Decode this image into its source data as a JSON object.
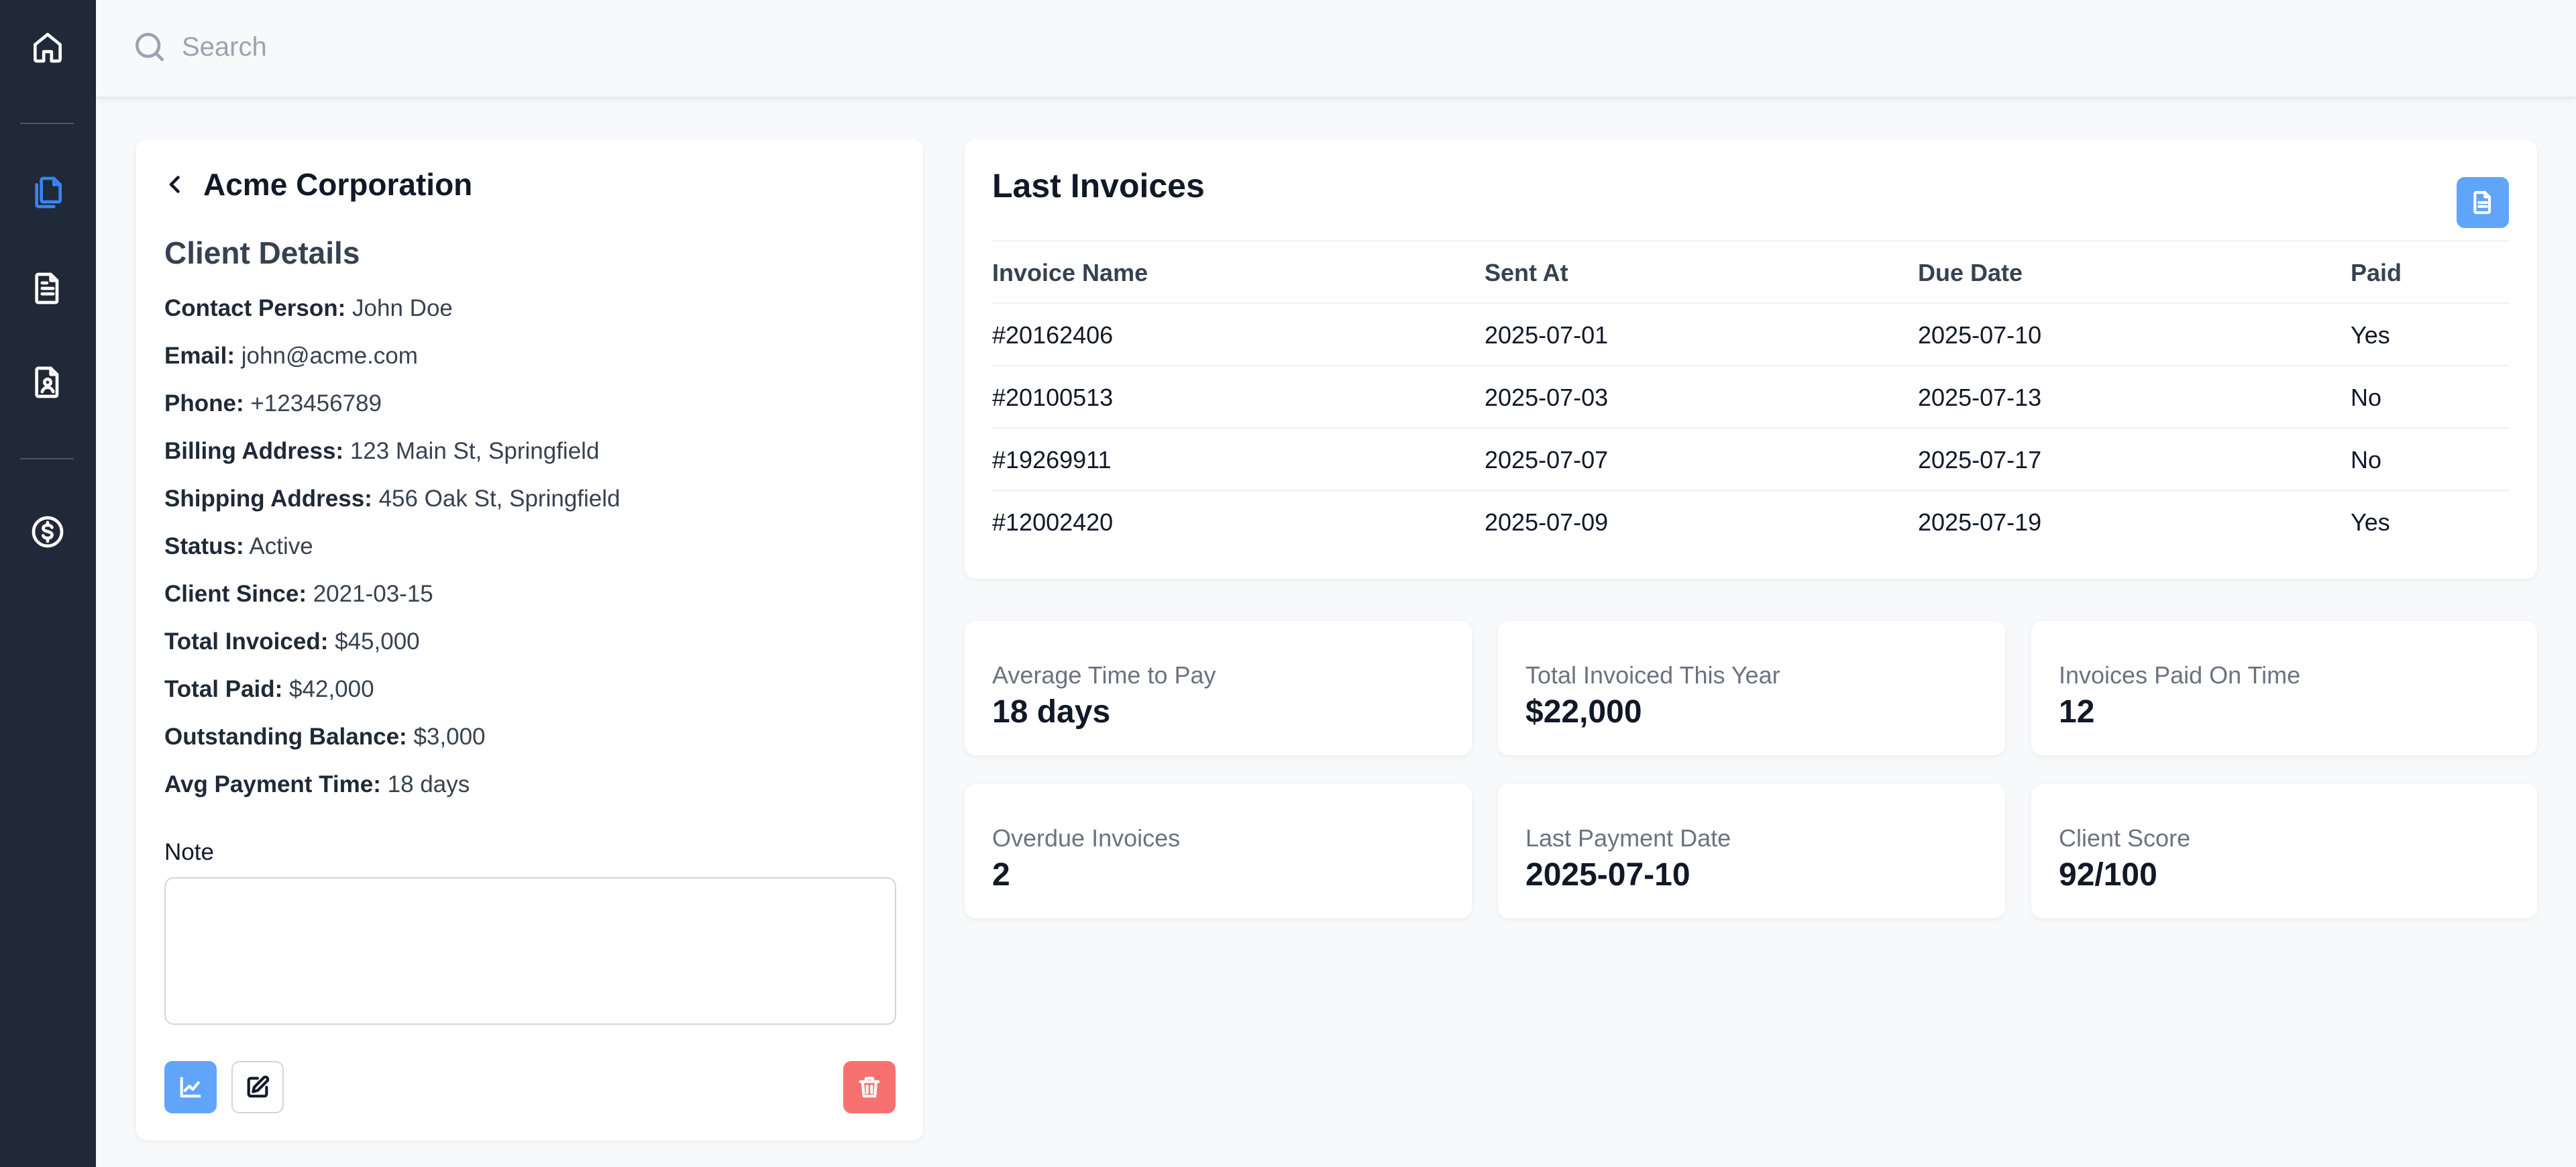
{
  "search": {
    "placeholder": "Search",
    "value": ""
  },
  "sidebar": {
    "items": [
      {
        "icon": "home-icon",
        "active": false
      },
      {
        "icon": "copy-documents-icon",
        "active": true
      },
      {
        "icon": "document-text-icon",
        "active": false
      },
      {
        "icon": "contact-document-icon",
        "active": false
      },
      {
        "icon": "dollar-circle-icon",
        "active": false
      }
    ]
  },
  "client": {
    "name": "Acme Corporation",
    "section_title": "Client Details",
    "details": [
      {
        "label": "Contact Person:",
        "value": "John Doe"
      },
      {
        "label": "Email:",
        "value": "john@acme.com"
      },
      {
        "label": "Phone:",
        "value": "+123456789"
      },
      {
        "label": "Billing Address:",
        "value": "123 Main St, Springfield"
      },
      {
        "label": "Shipping Address:",
        "value": "456 Oak St, Springfield"
      },
      {
        "label": "Status:",
        "value": "Active"
      },
      {
        "label": "Client Since:",
        "value": "2021-03-15"
      },
      {
        "label": "Total Invoiced:",
        "value": "$45,000"
      },
      {
        "label": "Total Paid:",
        "value": "$42,000"
      },
      {
        "label": "Outstanding Balance:",
        "value": "$3,000"
      },
      {
        "label": "Avg Payment Time:",
        "value": "18 days"
      }
    ],
    "note_label": "Note",
    "note_value": ""
  },
  "invoices": {
    "title": "Last Invoices",
    "columns": [
      "Invoice Name",
      "Sent At",
      "Due Date",
      "Paid"
    ],
    "rows": [
      [
        "#20162406",
        "2025-07-01",
        "2025-07-10",
        "Yes"
      ],
      [
        "#20100513",
        "2025-07-03",
        "2025-07-13",
        "No"
      ],
      [
        "#19269911",
        "2025-07-07",
        "2025-07-17",
        "No"
      ],
      [
        "#12002420",
        "2025-07-09",
        "2025-07-19",
        "Yes"
      ]
    ]
  },
  "stats": [
    {
      "label": "Average Time to Pay",
      "value": "18 days"
    },
    {
      "label": "Total Invoiced This Year",
      "value": "$22,000"
    },
    {
      "label": "Invoices Paid On Time",
      "value": "12"
    },
    {
      "label": "Overdue Invoices",
      "value": "2"
    },
    {
      "label": "Last Payment Date",
      "value": "2025-07-10"
    },
    {
      "label": "Client Score",
      "value": "92/100"
    }
  ],
  "colors": {
    "sidebar_bg": "#1f2937",
    "accent": "#3b82f6",
    "button_blue": "#60a5fa",
    "button_red": "#f87171"
  }
}
